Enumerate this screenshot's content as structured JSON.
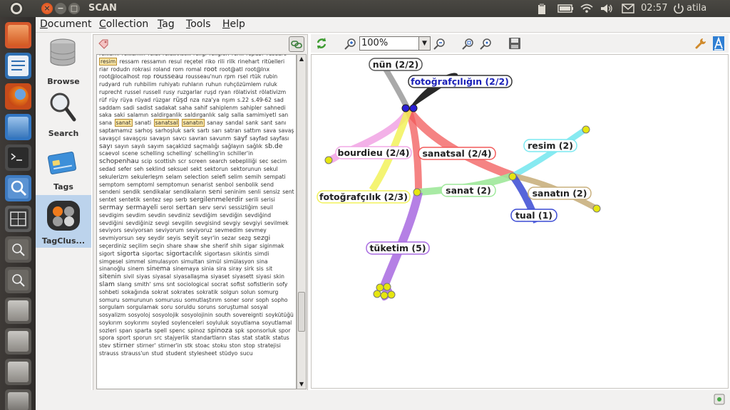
{
  "window": {
    "title": "SCAN"
  },
  "tray": {
    "clock": "02:57",
    "user": "atila"
  },
  "menu": {
    "items": [
      {
        "label": "Document",
        "mnemonic": "D",
        "rest": "ocument"
      },
      {
        "label": "Collection",
        "mnemonic": "C",
        "rest": "ollection"
      },
      {
        "label": "Tag",
        "mnemonic": "T",
        "rest": "ag"
      },
      {
        "label": "Tools",
        "mnemonic": "T",
        "rest": "ools"
      },
      {
        "label": "Help",
        "mnemonic": "H",
        "rest": "elp"
      }
    ]
  },
  "nav": {
    "browse": "Browse",
    "search": "Search",
    "tags": "Tags",
    "tagclus": "TagClus..."
  },
  "graph": {
    "zoom": "100%",
    "nodes": {
      "nun": "nün (2/2)",
      "fotografciligin": "fotoğrafçılığın (2/2)",
      "bourdieu": "bourdieu (2/4)",
      "sanatsal": "sanatsal (2/4)",
      "fotografcilik": "fotoğrafçılık (2/3)",
      "sanat": "sanat (2)",
      "resim": "resim (2)",
      "sanatin": "sanatın (2)",
      "tual": "tual (1)",
      "tuketim": "tüketim (5)"
    }
  },
  "colors": {
    "panel_bg": "#f2f1f0",
    "accent_orange": "#e07a1f",
    "selection_blue": "#bcd3ec",
    "node_yellow": "#e6e60f"
  },
  "tag_cloud": [
    "reklamı",
    "reklamın",
    "relat",
    "relativistik",
    "religi",
    "religion",
    "renk",
    "repubr",
    "researc",
    "resim",
    "ressam",
    "ressamın",
    "resul",
    "reçetel",
    "riko",
    "rili",
    "rilk",
    "rinehart",
    "ritüelleri",
    "riar",
    "rodudn",
    "rokrasi",
    "roland",
    "rom",
    "romal",
    "root",
    "root@atl",
    "root@lnx",
    "root@localhost",
    "rop",
    "rousseau",
    "rousseau'nun",
    "rpm",
    "rsel",
    "rtük",
    "rubin",
    "rudyard",
    "ruh",
    "ruhbilim",
    "ruhiyatı",
    "ruhların",
    "ruhun",
    "ruhçözümlem",
    "ruluk",
    "ruprecht",
    "russel",
    "russell",
    "rusy",
    "ruzgarlar",
    "ruşd",
    "ryan",
    "rölativist",
    "rölativizm",
    "rüf",
    "rüy",
    "rüya",
    "rüyad",
    "rüzgar",
    "rüşd",
    "nza",
    "nza'ya",
    "nşım",
    "s.22",
    "s.49-62",
    "sad",
    "saddam",
    "sadi",
    "sadist",
    "sadakat",
    "saha",
    "sahif",
    "sahiplenm",
    "sahipler",
    "sahnedi",
    "saka",
    "saki",
    "salamın",
    "saldirganlik",
    "saldırganlık",
    "salg",
    "salla",
    "samimiyetl",
    "san",
    "sana",
    "sanat",
    "sanati",
    "sanatsal",
    "sanatın",
    "sanay",
    "sandal",
    "sank",
    "sant",
    "sanı",
    "saptamamız",
    "sarhoş",
    "sarhoşluk",
    "sark",
    "sartı",
    "sarı",
    "satran",
    "sattım",
    "sava",
    "savaş",
    "savaşçıl",
    "savaşçısı",
    "savaşın",
    "savcı",
    "savran",
    "savunm",
    "sayf",
    "sayfad",
    "sayfası",
    "sayı",
    "sayın",
    "sayılı",
    "sayım",
    "saçaklızd",
    "saçmalığı",
    "sağlayın",
    "sağlık",
    "sb.de",
    "scaevol",
    "scene",
    "schelling",
    "schelling'",
    "schelling'in",
    "schiller'in",
    "schopenhau",
    "scip",
    "scottish",
    "scr",
    "screen",
    "search",
    "sebepliliği",
    "sec",
    "secim",
    "sedad",
    "sefer",
    "seh",
    "seklind",
    "seksuel",
    "sekt",
    "sektorun",
    "sektorunun",
    "sekul",
    "sekulerizm",
    "sekulerleşm",
    "selam",
    "selection",
    "selefi",
    "selim",
    "semih",
    "sempati",
    "semptom",
    "semptoml",
    "semptomun",
    "senarist",
    "senbol",
    "senbolik",
    "send",
    "sendeni",
    "sendik",
    "sendikalar",
    "sendikaların",
    "seni",
    "seninim",
    "senli",
    "sensiz",
    "sent",
    "sentet",
    "sentetik",
    "sentez",
    "sep",
    "serb",
    "sergilenmelerdir",
    "serili",
    "serisi",
    "sermay",
    "sermayeli",
    "serol",
    "sertan",
    "serv",
    "servi",
    "sessizliğim",
    "seuil",
    "sevdigim",
    "sevdim",
    "sevdin",
    "sevdiniz",
    "sevdiğim",
    "sevdiğin",
    "sevdiğind",
    "sevdiğini",
    "sevdiğiniz",
    "sevgi",
    "sevgilin",
    "sevgisind",
    "sevgiy",
    "sevgiyi",
    "sevilmek",
    "seviyors",
    "seviyorsan",
    "seviyorum",
    "seviyoruz",
    "sevmedim",
    "sevmey",
    "sevmiyorsun",
    "sey",
    "seydir",
    "seyis",
    "seyit",
    "seyr'in",
    "sezar",
    "sezg",
    "sezgi",
    "seçerdiniz",
    "seçilim",
    "seçin",
    "share",
    "shaw",
    "she",
    "sherif",
    "shih",
    "sigar",
    "siginmak",
    "sigort",
    "sigorta",
    "sigortac",
    "sigortacılık",
    "sigortasın",
    "sikintis",
    "simdi",
    "simgesel",
    "simmel",
    "simulasyon",
    "simultan",
    "simül",
    "simülasyon",
    "sina",
    "sinanoğlu",
    "sinem",
    "sinema",
    "sinemaya",
    "sinia",
    "sira",
    "siray",
    "sirk",
    "sis",
    "sit",
    "sitenin",
    "sivil",
    "siyas",
    "siyasal",
    "siyasallaşma",
    "siyaset",
    "siyasett",
    "siyasi",
    "skin",
    "slam",
    "slang",
    "smith'",
    "sms",
    "snt",
    "sociological",
    "socrat",
    "sofist",
    "sofistlerin",
    "sofy",
    "sohbeti",
    "sokağında",
    "sokrat",
    "sokrates",
    "sokratik",
    "solgun",
    "solun",
    "somurg",
    "somuru",
    "somurunun",
    "somurusu",
    "somutlaştırım",
    "soner",
    "sonr",
    "soph",
    "sopho",
    "sorgulam",
    "sorgulamak",
    "soru",
    "soruldu",
    "soruns",
    "soruştumal",
    "sosyal",
    "sosyalizm",
    "sosyoloj",
    "sosyolojik",
    "sosyolojinin",
    "south",
    "sovereignti",
    "soykütüğü",
    "soykırım",
    "soykırımı",
    "soyled",
    "soylenceleri",
    "soyluluk",
    "soyutlama",
    "soyutlamal",
    "sozleri",
    "span",
    "sparta",
    "spell",
    "spenc",
    "spinoz",
    "spinoza",
    "spk",
    "sponsorluk",
    "spor",
    "spora",
    "sport",
    "sporun",
    "src",
    "stajyerlik",
    "standartların",
    "stas",
    "stat",
    "statik",
    "status",
    "stev",
    "stirner",
    "stirner'",
    "stirner'in",
    "stk",
    "stoac",
    "stoku",
    "ston",
    "stop",
    "stratejisi",
    "strauss",
    "strauss'un",
    "stud",
    "student",
    "stylesheet",
    "stüdyo",
    "sucu"
  ]
}
